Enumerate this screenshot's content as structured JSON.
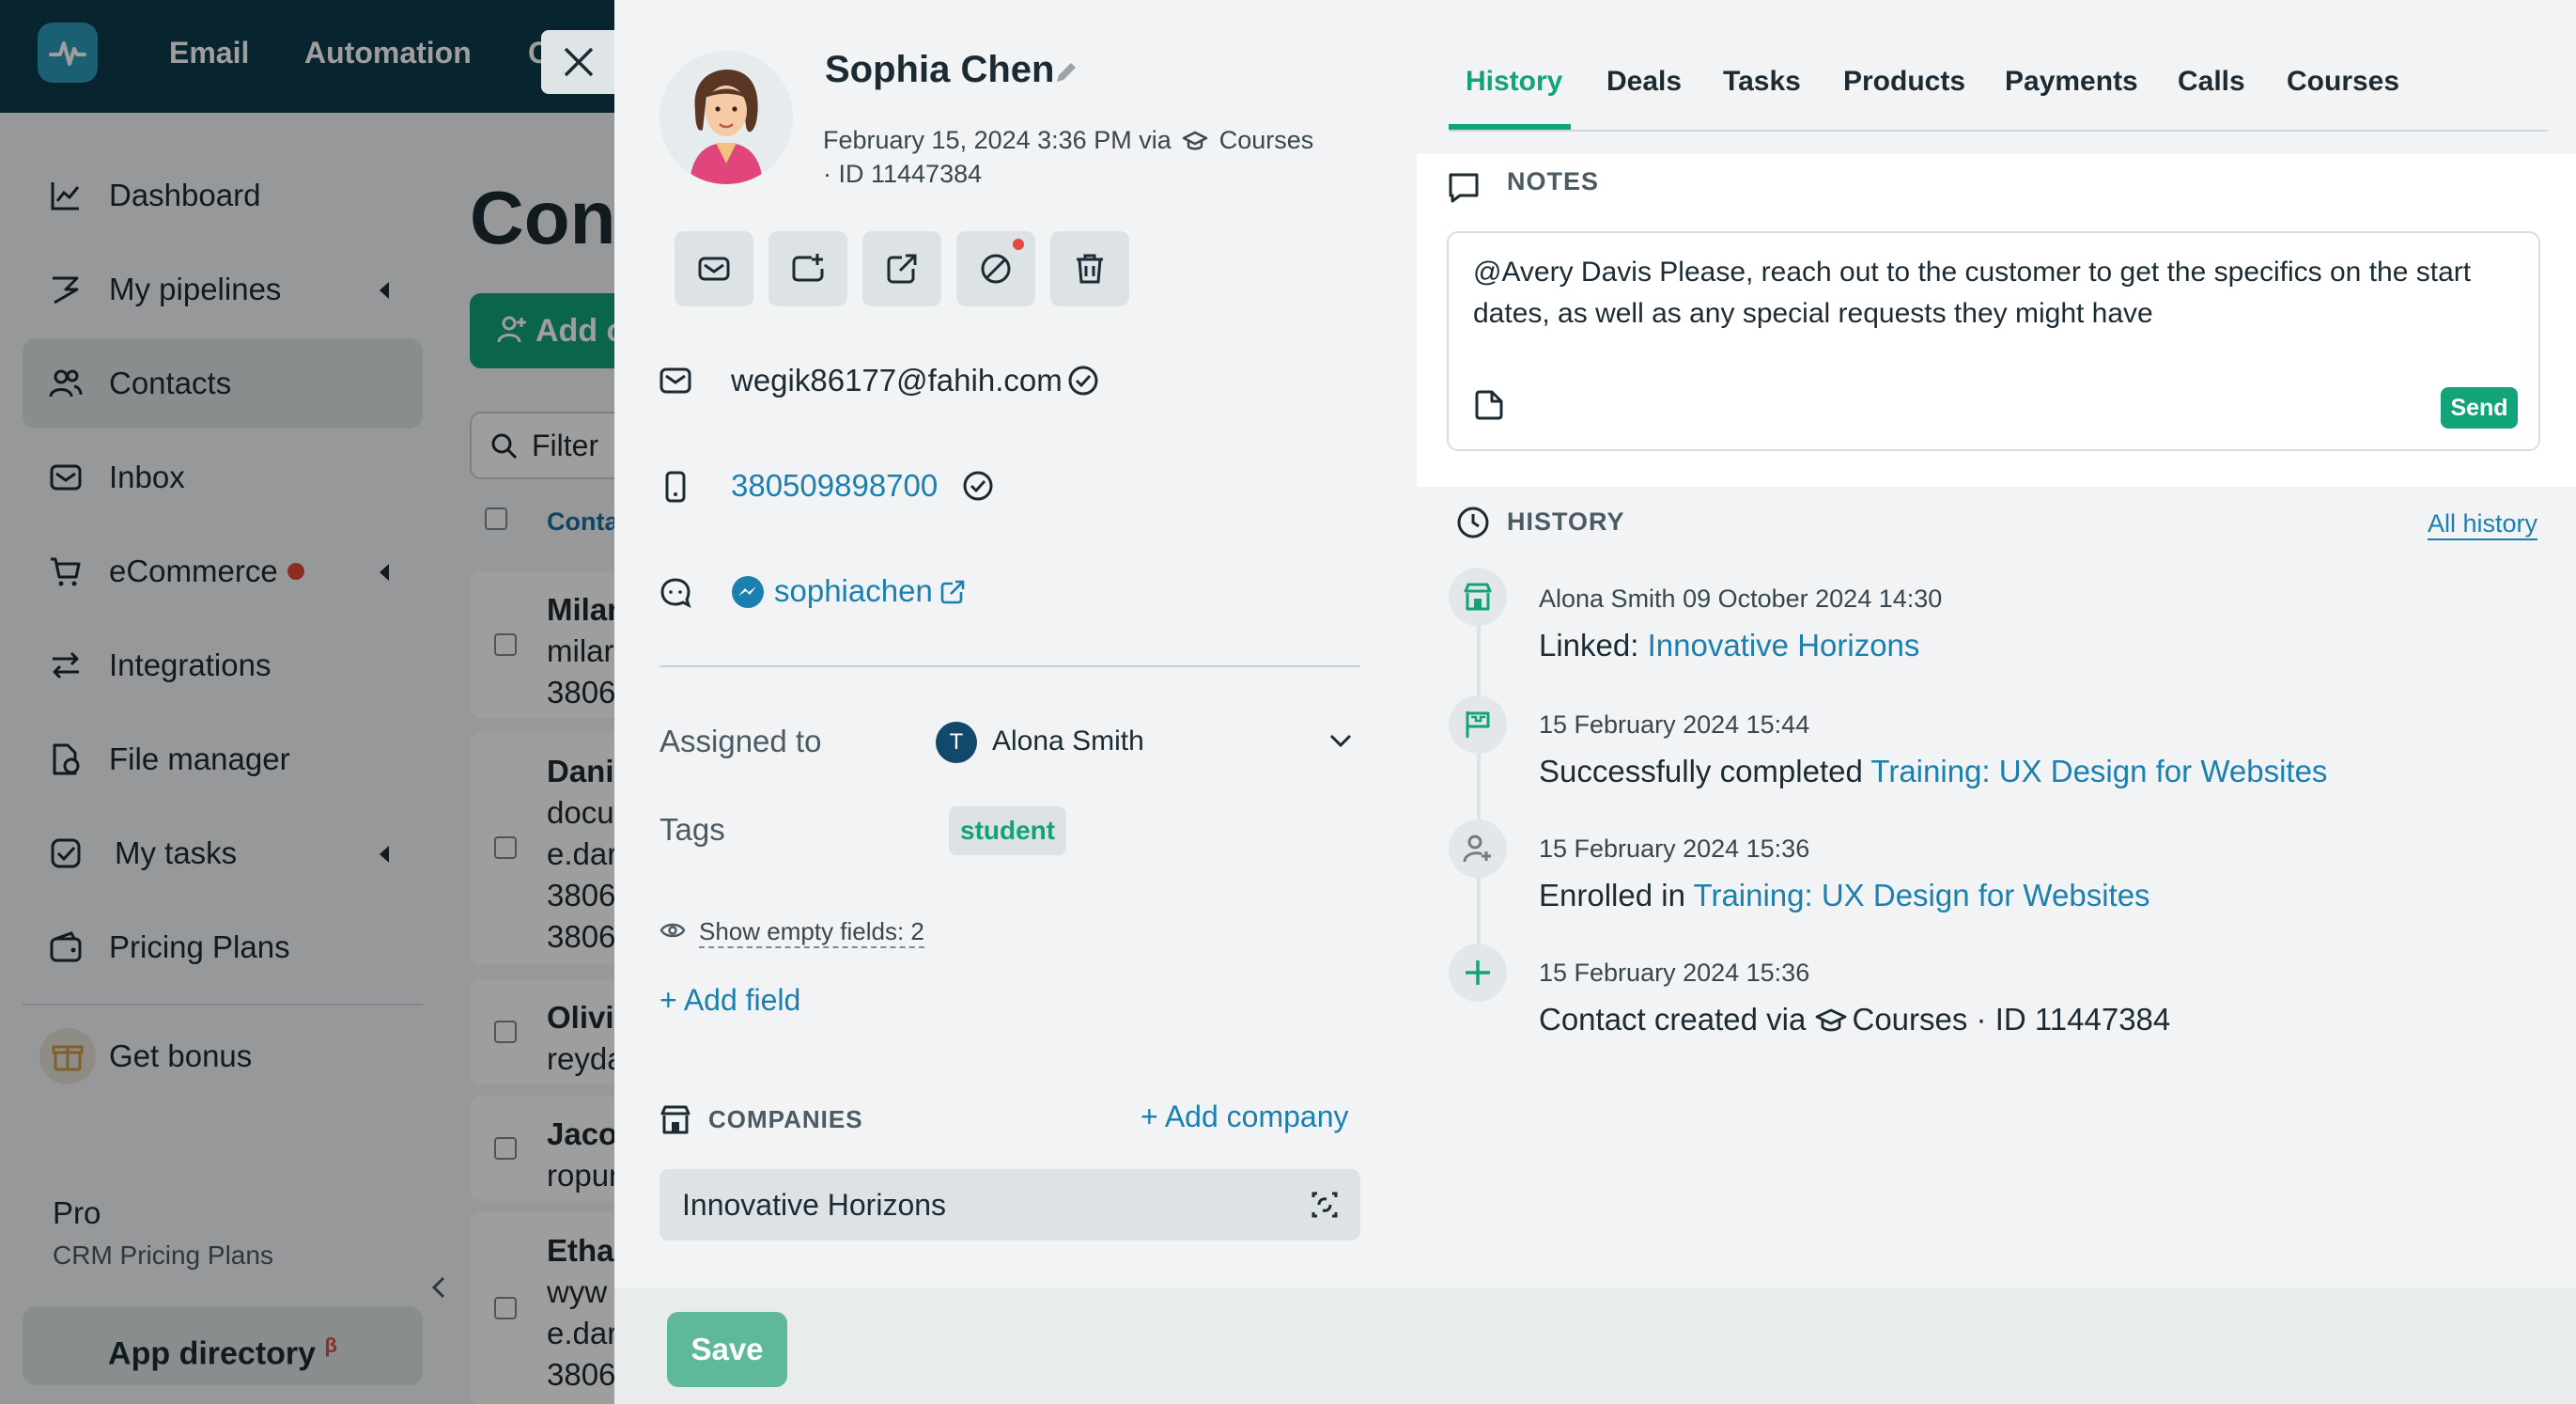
{
  "topbar": {
    "nav": [
      "Email",
      "Automation",
      "C"
    ]
  },
  "sidebar": {
    "items": [
      {
        "label": "Dashboard",
        "icon": "chart-line-icon"
      },
      {
        "label": "My pipelines",
        "icon": "pipeline-icon"
      },
      {
        "label": "Contacts",
        "icon": "contacts-icon"
      },
      {
        "label": "Inbox",
        "icon": "inbox-icon"
      },
      {
        "label": "eCommerce",
        "icon": "cart-icon"
      },
      {
        "label": "Integrations",
        "icon": "integrations-icon"
      },
      {
        "label": "File manager",
        "icon": "file-icon"
      },
      {
        "label": "My tasks",
        "icon": "tasks-icon"
      },
      {
        "label": "Pricing Plans",
        "icon": "wallet-icon"
      },
      {
        "label": "Get bonus",
        "icon": "gift-icon"
      }
    ],
    "plan_name": "Pro",
    "plan_sub": "CRM Pricing Plans",
    "app_directory": "App directory",
    "app_directory_badge": "β"
  },
  "contacts_list": {
    "title": "Con",
    "add_button": "Add c",
    "filter_placeholder": "Filter",
    "column_header": "Conta",
    "rows": [
      [
        "Milar",
        "milar",
        "3806"
      ],
      [
        "Danie",
        "docu",
        "e.dar",
        "3806",
        "3806"
      ],
      [
        "Olivia",
        "reyda"
      ],
      [
        "Jaco",
        "ropur"
      ],
      [
        "Ethar",
        "wyw",
        "e.dar",
        "3806"
      ]
    ]
  },
  "contact": {
    "name": "Sophia Chen",
    "created": "February 15, 2024 3:36 PM via",
    "created_source": "Courses",
    "id_line": "· ID 11447384",
    "email": "wegik86177@fahih.com",
    "phone": "380509898700",
    "messenger": "sophiachen",
    "assigned_label": "Assigned to",
    "assignee_initial": "T",
    "assignee": "Alona Smith",
    "tags_label": "Tags",
    "tag": "student",
    "show_empty": "Show empty fields: 2",
    "add_field": "+ Add field",
    "companies_title": "COMPANIES",
    "add_company": "+ Add company",
    "company": "Innovative Horizons",
    "save": "Save"
  },
  "tabs": [
    "History",
    "Deals",
    "Tasks",
    "Products",
    "Payments",
    "Calls",
    "Courses"
  ],
  "notes": {
    "title": "NOTES",
    "text": "@Avery Davis Please, reach out to the customer to get the specifics on the start dates, as well as any special requests they might have",
    "send": "Send"
  },
  "history": {
    "title": "HISTORY",
    "all_history": "All history",
    "events": [
      {
        "meta": "Alona Smith  09 October 2024 14:30",
        "prefix": "Linked: ",
        "link": "Innovative Horizons",
        "suffix": "",
        "icon": "store-icon"
      },
      {
        "meta": "15 February 2024 15:44",
        "prefix": "Successfully completed ",
        "link": "Training: UX Design for Websites",
        "suffix": "",
        "icon": "flag-icon"
      },
      {
        "meta": "15 February 2024 15:36",
        "prefix": "Enrolled in ",
        "link": "Training: UX Design for Websites",
        "suffix": "",
        "icon": "user-add-icon"
      },
      {
        "meta": "15 February 2024 15:36",
        "prefix": "Contact created via ",
        "link": "",
        "suffix": "Courses · ID 11447384",
        "icon": "plus-icon"
      }
    ]
  },
  "colors": {
    "header": "#0e3b4c",
    "accent": "#13a37b",
    "link": "#1b7fb0",
    "alert": "#e24a3b"
  }
}
